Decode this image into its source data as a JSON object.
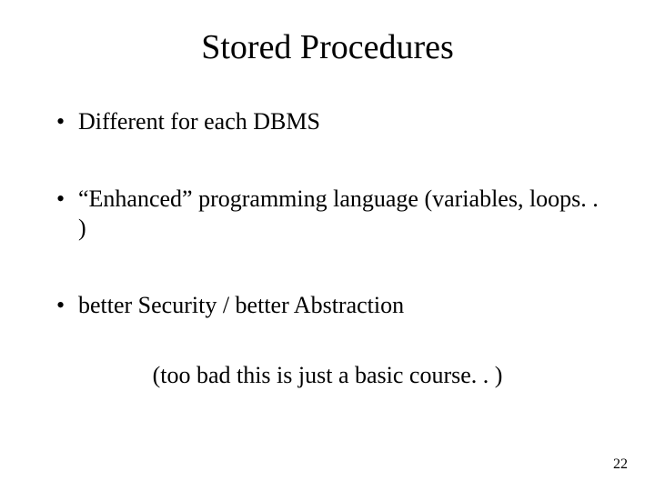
{
  "slide": {
    "title": "Stored Procedures",
    "bullets": [
      "Different for each DBMS",
      "“Enhanced” programming language (variables, loops. . )",
      "better Security / better Abstraction"
    ],
    "footnote": "(too bad this is just a basic course. . )",
    "page_number": "22"
  }
}
